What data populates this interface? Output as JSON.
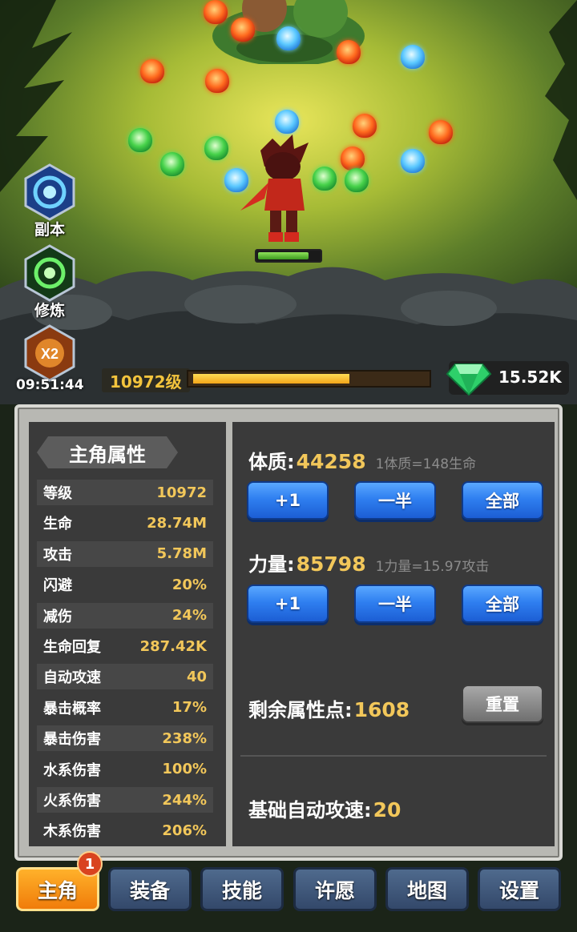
{
  "hud": {
    "side_buttons": [
      {
        "label": "副本",
        "icon": "vortex-icon"
      },
      {
        "label": "修炼",
        "icon": "swirl-icon"
      },
      {
        "label": "",
        "icon": "double-exp-icon",
        "badge": "X2"
      }
    ],
    "timer": "09:51:44",
    "level_label": "10972级",
    "exp_progress": 0.67,
    "gems": "15.52K",
    "hero_hp": 0.83
  },
  "stats_panel": {
    "title": "主角属性",
    "rows": [
      {
        "key": "等级",
        "value": "10972"
      },
      {
        "key": "生命",
        "value": "28.74M"
      },
      {
        "key": "攻击",
        "value": "5.78M"
      },
      {
        "key": "闪避",
        "value": "20%"
      },
      {
        "key": "减伤",
        "value": "24%"
      },
      {
        "key": "生命回复",
        "value": "287.42K"
      },
      {
        "key": "自动攻速",
        "value": "40"
      },
      {
        "key": "暴击概率",
        "value": "17%"
      },
      {
        "key": "暴击伤害",
        "value": "238%"
      },
      {
        "key": "水系伤害",
        "value": "100%"
      },
      {
        "key": "火系伤害",
        "value": "244%"
      },
      {
        "key": "木系伤害",
        "value": "206%"
      }
    ]
  },
  "attributes": {
    "constitution": {
      "name": "体质:",
      "value": "44258",
      "note": "1体质=148生命"
    },
    "strength": {
      "name": "力量:",
      "value": "85798",
      "note": "1力量=15.97攻击"
    },
    "buttons": {
      "plus_one": "+1",
      "half": "一半",
      "all": "全部"
    },
    "remaining_label": "剩余属性点:",
    "remaining_value": "1608",
    "reset_button": "重置",
    "base_speed_label": "基础自动攻速:",
    "base_speed_value": "20"
  },
  "nav": {
    "tabs": [
      "主角",
      "装备",
      "技能",
      "许愿",
      "地图",
      "设置"
    ],
    "active_index": 0,
    "badge_count": "1"
  },
  "colors": {
    "accent_gold": "#f2c75a",
    "button_blue": "#2f7ff0",
    "active_tab": "#f5901a"
  }
}
